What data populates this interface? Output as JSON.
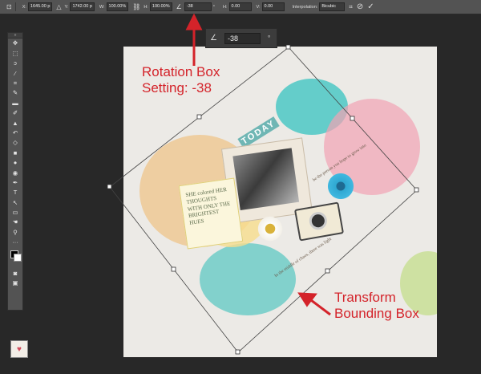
{
  "options_bar": {
    "x_label": "X:",
    "x_value": "1645.00 p",
    "y_label": "Y:",
    "y_value": "1742.00 p",
    "w_label": "W:",
    "w_value": "100.00%",
    "h_label": "H:",
    "h_value": "100.00%",
    "angle_value": "-38",
    "hskew_label": "H:",
    "hskew_value": "0.00",
    "vskew_label": "V:",
    "vskew_value": "0.00",
    "interp_label": "Interpolation:",
    "interp_value": "Bicubic"
  },
  "rotation_popup": {
    "value": "-38",
    "degree_symbol": "°"
  },
  "annotations": {
    "rotation": [
      "Rotation Box",
      "Setting: -38"
    ],
    "transform": [
      "Transform",
      "Bounding Box"
    ]
  },
  "colors": {
    "annotation": "#d4232a",
    "ui_panel": "#535353",
    "canvas": "#eceae6"
  },
  "canvas_art": {
    "today": "TODAY",
    "quote_card": "SHE colored HER THOUGHTS WITH ONLY THE BRIGHTEST HUES",
    "caption_1": "In the middle of chaos, there was light",
    "caption_2": "be the person you hope to grow into"
  },
  "tools": [
    "move-icon",
    "marquee-icon",
    "lasso-icon",
    "magic-wand-icon",
    "crop-icon",
    "eyedropper-icon",
    "healing-icon",
    "brush-icon",
    "stamp-icon",
    "history-brush-icon",
    "eraser-icon",
    "gradient-icon",
    "blur-icon",
    "dodge-icon",
    "pen-icon",
    "type-icon",
    "path-select-icon",
    "shape-icon",
    "hand-icon",
    "zoom-icon",
    "more-icon"
  ]
}
